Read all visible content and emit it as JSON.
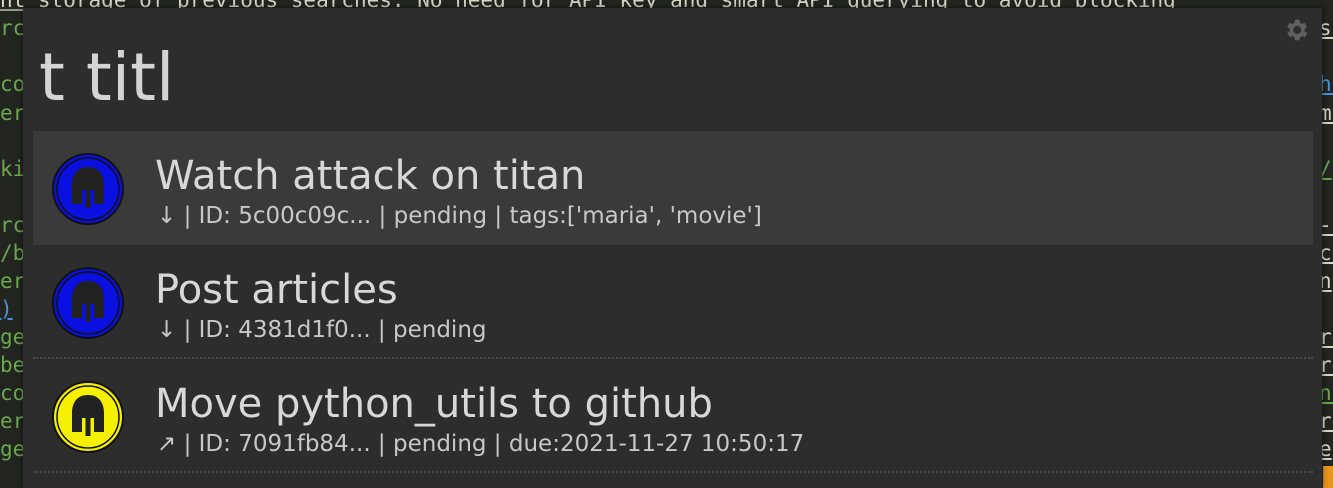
{
  "background_editor": {
    "top_line": "ht storage of previous searches. No need for API key and smart API querying to avoid blocking",
    "left_fragments": [
      {
        "text": "rc",
        "color": "#6aa84f"
      },
      {
        "text": "co",
        "color": "#6aa84f"
      },
      {
        "text": "er",
        "color": "#6aa84f"
      },
      {
        "text": "ki",
        "color": "#6aa84f"
      },
      {
        "text": "rc",
        "color": "#6aa84f"
      },
      {
        "text": "/b",
        "color": "#6aa84f"
      },
      {
        "text": "er",
        "color": "#6aa84f"
      },
      {
        "text": ")",
        "color": "#4f8fe0"
      },
      {
        "text": "ge",
        "color": "#6aa84f"
      },
      {
        "text": "be",
        "color": "#6aa84f"
      },
      {
        "text": "co",
        "color": "#6aa84f"
      },
      {
        "text": "er",
        "color": "#6aa84f"
      },
      {
        "text": "ge",
        "color": "#6aa84f"
      }
    ],
    "right_fragments": [
      {
        "text": "ss",
        "color": "#d7d7c9"
      },
      {
        "text": "he",
        "color": "#4f8fe0"
      },
      {
        "text": "ma",
        "color": "#d7d7c9"
      },
      {
        "text": "/",
        "color": "#6aa84f"
      },
      {
        "text": "-s",
        "color": "#d7d7c9"
      },
      {
        "text": "co",
        "color": "#d7d7c9"
      },
      {
        "text": "n",
        "color": "#d7d7c9"
      },
      {
        "text": "re",
        "color": "#d7d7c9"
      },
      {
        "text": "re",
        "color": "#d7d7c9"
      },
      {
        "text": "na",
        "color": "#6aa84f"
      },
      {
        "text": "re",
        "color": "#d7d7c9"
      },
      {
        "text": "e",
        "color": "#d7d7c9"
      }
    ]
  },
  "launcher": {
    "query": "t titl",
    "settings_icon": "gear-icon",
    "results": [
      {
        "title": "Watch attack on titan",
        "subtitle": "↓ | ID: 5c00c09c... | pending | tags:['maria', 'movie']",
        "icon": "spartan-helmet-icon",
        "icon_color": "#0a10e0",
        "selected": true
      },
      {
        "title": "Post articles",
        "subtitle": "↓ | ID: 4381d1f0... | pending",
        "icon": "spartan-helmet-icon",
        "icon_color": "#0a10e0",
        "selected": false
      },
      {
        "title": "Move python_utils to github",
        "subtitle": "↗ | ID: 7091fb84... | pending | due:2021-11-27 10:50:17",
        "icon": "spartan-helmet-icon",
        "icon_color": "#f5f000",
        "selected": false
      }
    ]
  }
}
